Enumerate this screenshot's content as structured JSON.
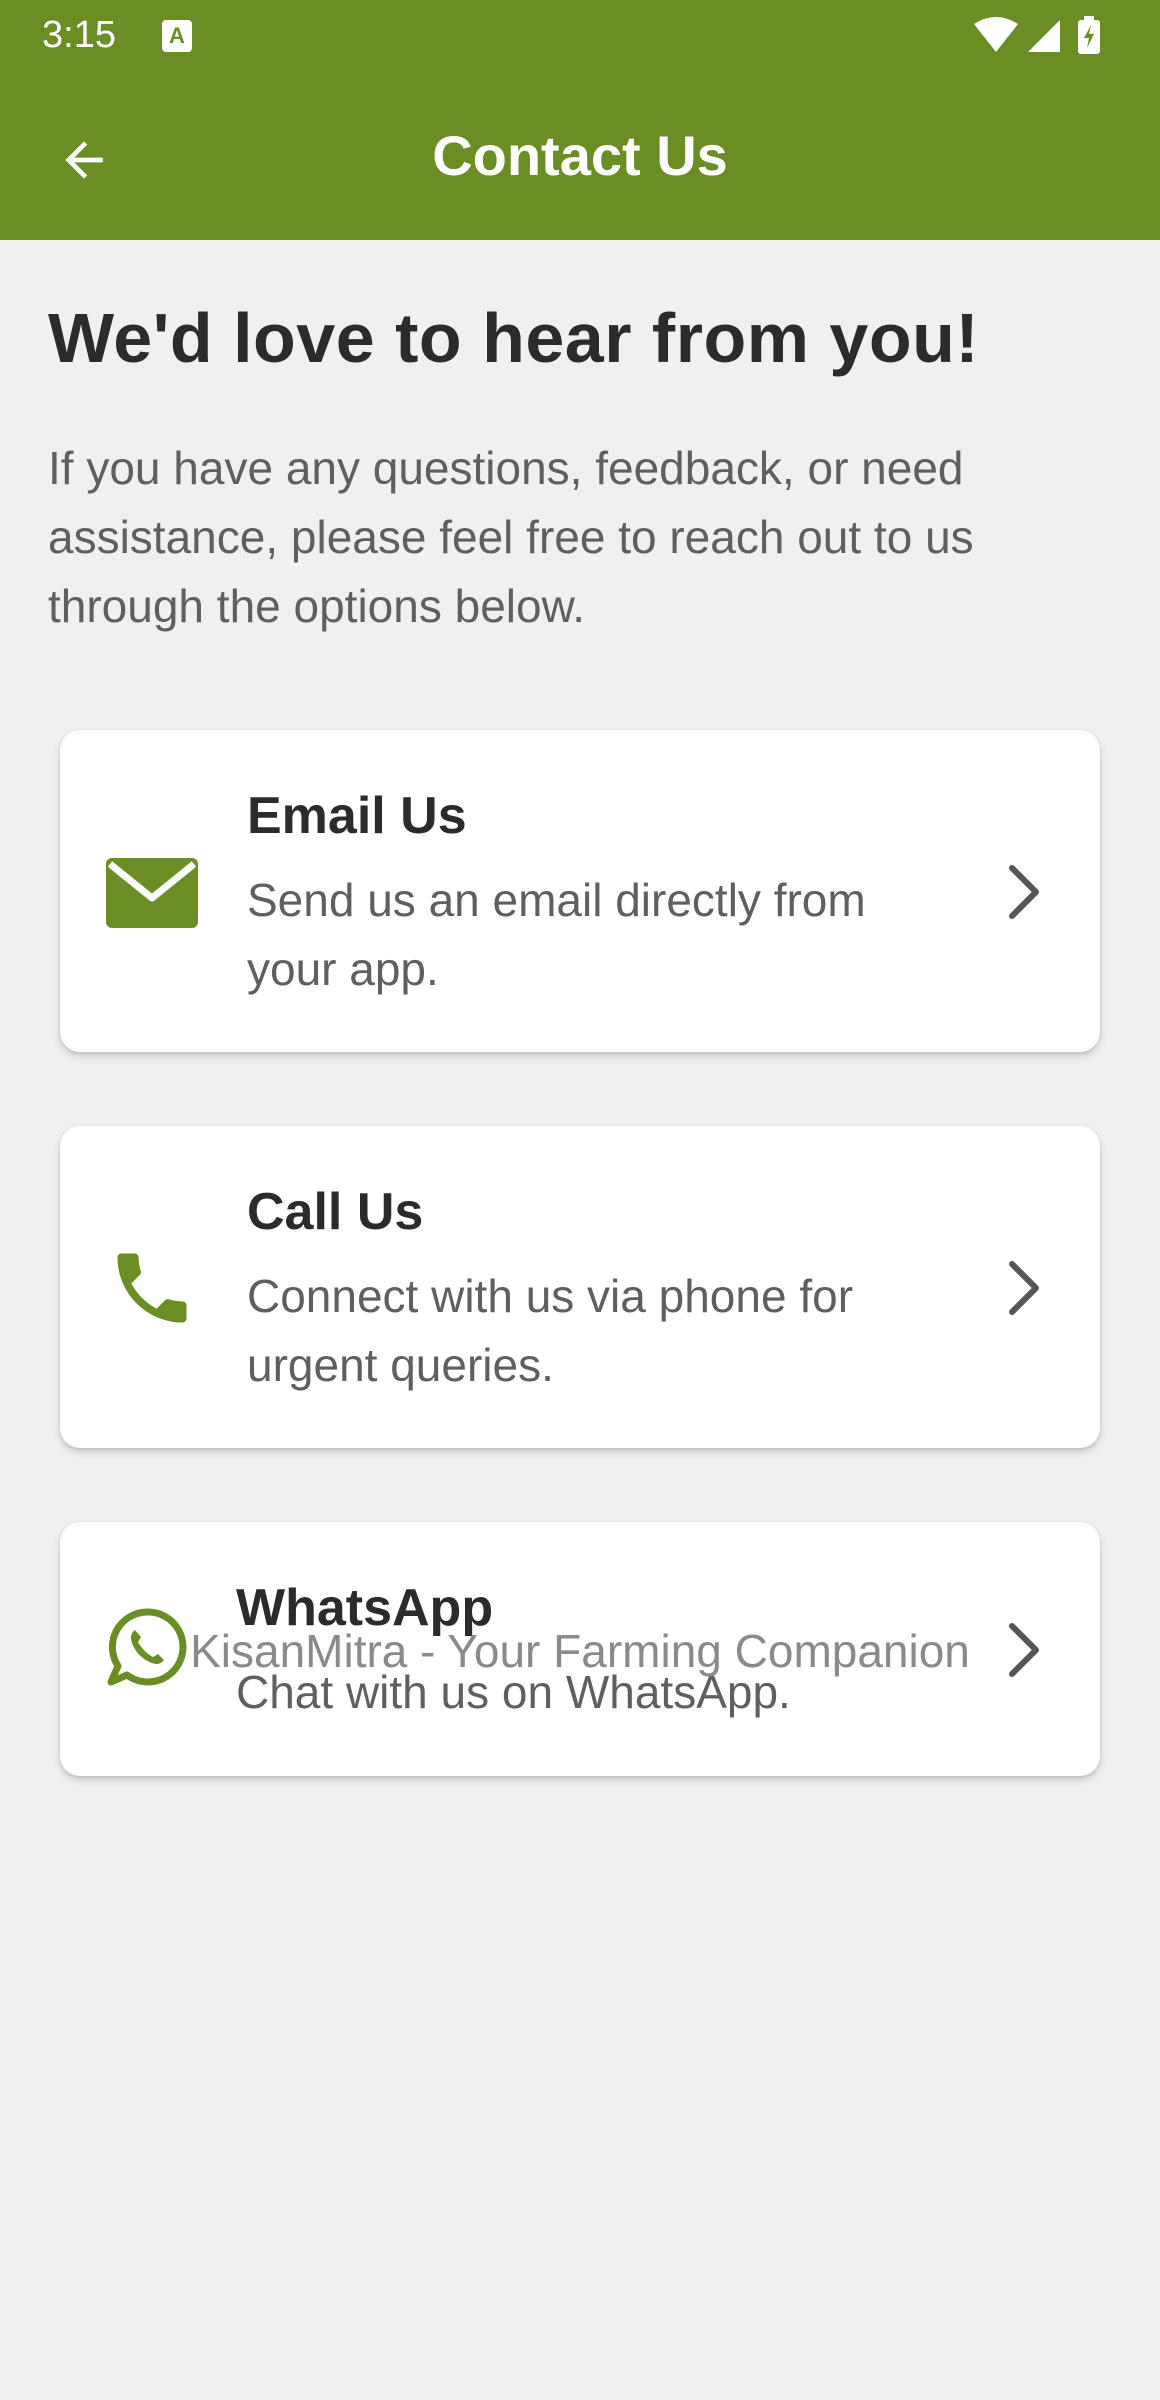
{
  "status_bar": {
    "time": "3:15",
    "notification_badge": "A"
  },
  "app_bar": {
    "title": "Contact Us",
    "back_icon": "arrow-back-icon"
  },
  "main": {
    "heading": "We'd love to hear from you!",
    "intro": "If you have any questions, feedback, or need assistance, please feel free to reach out to us through the options below."
  },
  "options": [
    {
      "icon": "email-icon",
      "title": "Email Us",
      "description": "Send us an email directly from your app."
    },
    {
      "icon": "phone-icon",
      "title": "Call Us",
      "description": "Connect with us via phone for urgent queries."
    },
    {
      "icon": "whatsapp-icon",
      "title": "WhatsApp",
      "description": "Chat with us on WhatsApp."
    }
  ],
  "footer": {
    "tagline": "KisanMitra - Your Farming Companion"
  },
  "colors": {
    "brand_green": "#6a8e23",
    "background": "#f0f0f0",
    "card": "#ffffff",
    "heading_text": "#2b2b2b",
    "body_text": "#5f5f5f",
    "footer_text": "#8a8a8a"
  }
}
